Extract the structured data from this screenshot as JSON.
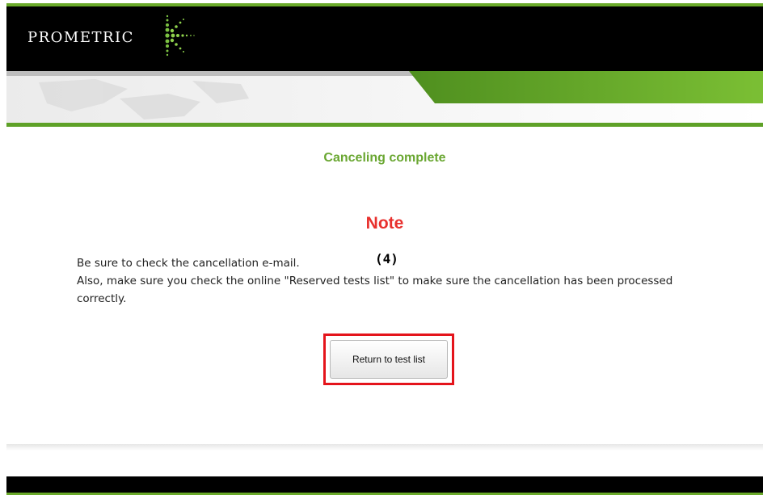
{
  "header": {
    "logo_text": "PROMETRIC",
    "brand_colors": {
      "green": "#6aaa2a",
      "black": "#000000"
    }
  },
  "main": {
    "title": "Canceling complete",
    "note_heading": "Note",
    "message_line1": "Be sure to check the cancellation e-mail.",
    "marker": "(4)",
    "message_line2": "Also, make sure you check the online \"Reserved tests list\" to make sure the cancellation has been processed correctly.",
    "return_button": "Return to test list",
    "colors": {
      "title": "#6aa732",
      "note": "#e8302d",
      "highlight": "#e4141b"
    }
  }
}
